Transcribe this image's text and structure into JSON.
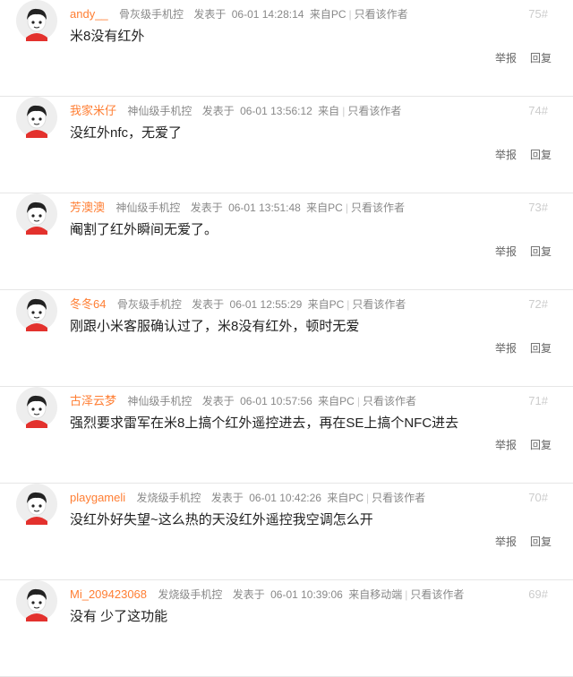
{
  "posts": [
    {
      "user": "andy__",
      "level": "骨灰级手机控",
      "posted": "发表于",
      "time": "06-01 14:28:14",
      "source": "来自PC",
      "only_author": "只看该作者",
      "floor": "75#",
      "content": "米8没有红外",
      "report": "举报",
      "reply": "回复"
    },
    {
      "user": "我家米仔",
      "level": "神仙级手机控",
      "posted": "发表于",
      "time": "06-01 13:56:12",
      "source": "来自",
      "only_author": "只看该作者",
      "floor": "74#",
      "content": "没红外nfc，无爱了",
      "report": "举报",
      "reply": "回复"
    },
    {
      "user": "芳澳澳",
      "level": "神仙级手机控",
      "posted": "发表于",
      "time": "06-01 13:51:48",
      "source": "来自PC",
      "only_author": "只看该作者",
      "floor": "73#",
      "content": "阉割了红外瞬间无爱了。",
      "report": "举报",
      "reply": "回复"
    },
    {
      "user": "冬冬64",
      "level": "骨灰级手机控",
      "posted": "发表于",
      "time": "06-01 12:55:29",
      "source": "来自PC",
      "only_author": "只看该作者",
      "floor": "72#",
      "content": "刚跟小米客服确认过了，米8没有红外，顿时无爱",
      "report": "举报",
      "reply": "回复"
    },
    {
      "user": "古泽云梦",
      "level": "神仙级手机控",
      "posted": "发表于",
      "time": "06-01 10:57:56",
      "source": "来自PC",
      "only_author": "只看该作者",
      "floor": "71#",
      "content": "强烈要求雷军在米8上搞个红外遥控进去，再在SE上搞个NFC进去",
      "report": "举报",
      "reply": "回复"
    },
    {
      "user": "playgameli",
      "level": "发烧级手机控",
      "posted": "发表于",
      "time": "06-01 10:42:26",
      "source": "来自PC",
      "only_author": "只看该作者",
      "floor": "70#",
      "content": "没红外好失望~这么热的天没红外遥控我空调怎么开",
      "report": "举报",
      "reply": "回复"
    },
    {
      "user": "Mi_209423068",
      "level": "发烧级手机控",
      "posted": "发表于",
      "time": "06-01 10:39:06",
      "source": "来自移动端",
      "only_author": "只看该作者",
      "floor": "69#",
      "content": "没有 少了这功能",
      "report": "",
      "reply": ""
    }
  ]
}
